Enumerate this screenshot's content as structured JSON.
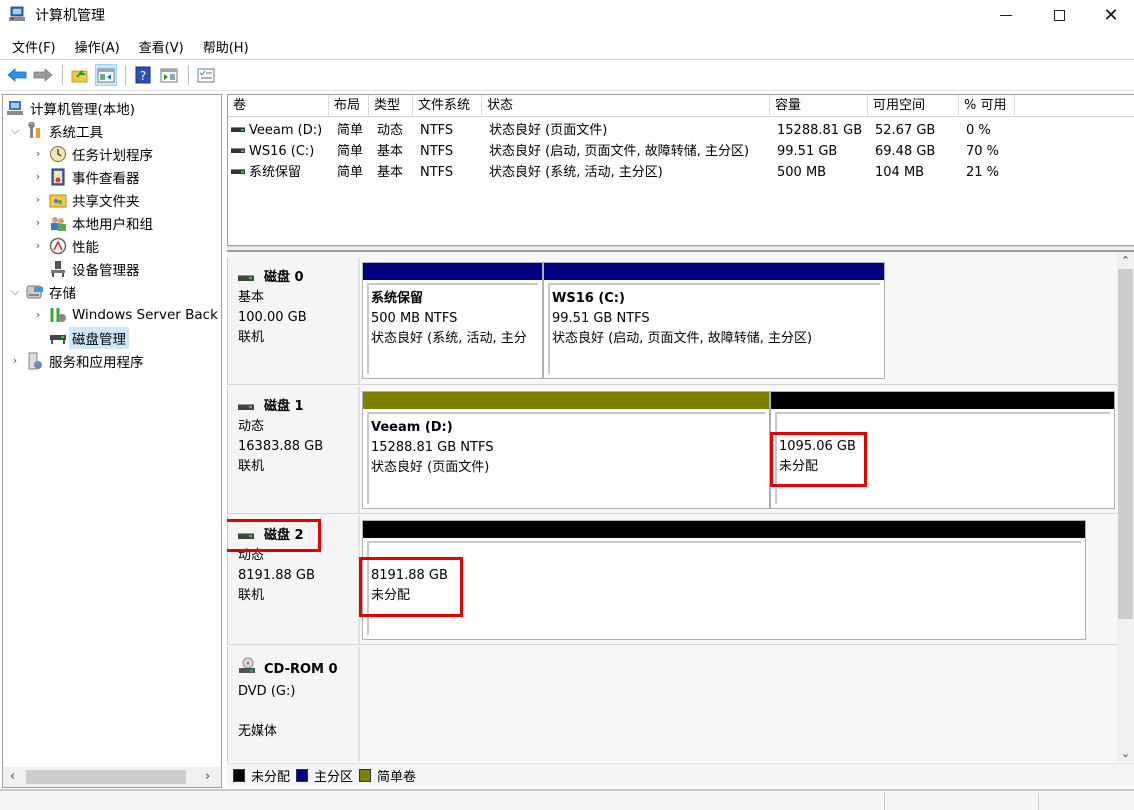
{
  "window": {
    "title": "计算机管理",
    "minimize": "minimize",
    "maximize": "maximize",
    "close": "close"
  },
  "menu": [
    "文件(F)",
    "操作(A)",
    "查看(V)",
    "帮助(H)"
  ],
  "toolbar": [
    "back-arrow",
    "forward-arrow",
    "up-folder",
    "show-hide-console-tree",
    "help",
    "show-action-pane",
    "properties"
  ],
  "tree": {
    "root": "计算机管理(本地)",
    "items": [
      {
        "label": "系统工具",
        "level": 1,
        "expanded": true,
        "icon": "tools-icon"
      },
      {
        "label": "任务计划程序",
        "level": 2,
        "icon": "clock-icon"
      },
      {
        "label": "事件查看器",
        "level": 2,
        "icon": "event-log-icon"
      },
      {
        "label": "共享文件夹",
        "level": 2,
        "icon": "shared-folder-icon"
      },
      {
        "label": "本地用户和组",
        "level": 2,
        "icon": "users-icon"
      },
      {
        "label": "性能",
        "level": 2,
        "icon": "performance-icon"
      },
      {
        "label": "设备管理器",
        "level": 2,
        "icon": "device-manager-icon"
      },
      {
        "label": "存储",
        "level": 1,
        "expanded": true,
        "icon": "storage-icon"
      },
      {
        "label": "Windows Server Back",
        "level": 2,
        "icon": "backup-icon"
      },
      {
        "label": "磁盘管理",
        "level": 2,
        "icon": "disk-icon",
        "selected": true
      },
      {
        "label": "服务和应用程序",
        "level": 1,
        "icon": "services-icon"
      }
    ]
  },
  "volume_table": {
    "columns": [
      "卷",
      "布局",
      "类型",
      "文件系统",
      "状态",
      "容量",
      "可用空间",
      "% 可用"
    ],
    "rows": [
      [
        "Veeam (D:)",
        "简单",
        "动态",
        "NTFS",
        "状态良好 (页面文件)",
        "15288.81 GB",
        "52.67 GB",
        "0 %"
      ],
      [
        "WS16 (C:)",
        "简单",
        "基本",
        "NTFS",
        "状态良好 (启动, 页面文件, 故障转储, 主分区)",
        "99.51 GB",
        "69.48 GB",
        "70 %"
      ],
      [
        "系统保留",
        "简单",
        "基本",
        "NTFS",
        "状态良好 (系统, 活动, 主分区)",
        "500 MB",
        "104 MB",
        "21 %"
      ]
    ]
  },
  "disks": [
    {
      "name": "磁盘 0",
      "type": "基本",
      "size": "100.00 GB",
      "status": "联机",
      "partitions": [
        {
          "name": "系统保留",
          "size": "500 MB NTFS",
          "status": "状态良好 (系统, 活动, 主分",
          "kind": "primary"
        },
        {
          "name": "WS16  (C:)",
          "size": "99.51 GB NTFS",
          "status": "状态良好 (启动, 页面文件, 故障转储, 主分区)",
          "kind": "primary"
        }
      ]
    },
    {
      "name": "磁盘 1",
      "type": "动态",
      "size": "16383.88 GB",
      "status": "联机",
      "partitions": [
        {
          "name": "Veeam  (D:)",
          "size": "15288.81 GB NTFS",
          "status": "状态良好 (页面文件)",
          "kind": "simple"
        },
        {
          "name": "",
          "size": "1095.06 GB",
          "status": "未分配",
          "kind": "unallocated",
          "highlighted": true
        }
      ]
    },
    {
      "name": "磁盘 2",
      "type": "动态",
      "size": "8191.88 GB",
      "status": "联机",
      "highlighted": true,
      "partitions": [
        {
          "name": "",
          "size": "8191.88 GB",
          "status": "未分配",
          "kind": "unallocated",
          "highlighted": true
        }
      ]
    },
    {
      "name": "CD-ROM 0",
      "type": "DVD (G:)",
      "size": "",
      "status": "无媒体",
      "partitions": []
    }
  ],
  "legend": [
    {
      "label": "未分配",
      "color": "#000000"
    },
    {
      "label": "主分区",
      "color": "#000080"
    },
    {
      "label": "简单卷",
      "color": "#808000"
    }
  ],
  "colors": {
    "primary": "#000080",
    "simple": "#808000",
    "unallocated": "#000000",
    "highlight": "#e00000",
    "selection": "#cce8ff"
  }
}
